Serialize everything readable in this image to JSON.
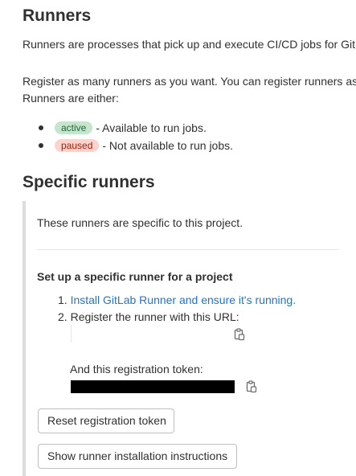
{
  "runners": {
    "title": "Runners",
    "intro": "Runners are processes that pick up and execute CI/CD jobs for GitLab.",
    "register_line1": "Register as many runners as you want. You can register runners as separate users, on separate servers, and on your local machine.",
    "register_line2": "Runners are either:",
    "statuses": [
      {
        "badge": "active",
        "text": "- Available to run jobs.",
        "color": "#c3e6cd"
      },
      {
        "badge": "paused",
        "text": "- Not available to run jobs.",
        "color": "#fdd4cd"
      }
    ]
  },
  "specific": {
    "title": "Specific runners",
    "description": "These runners are specific to this project.",
    "setup_title": "Set up a specific runner for a project",
    "steps": {
      "step1_link": "Install GitLab Runner and ensure it's running.",
      "step2_text": "Register the runner with this URL:"
    },
    "token_label": "And this registration token:",
    "reset_button": "Reset registration token",
    "show_button": "Show runner installation instructions"
  },
  "icons": {
    "copy_url": "clipboard-icon",
    "copy_token": "clipboard-icon"
  },
  "colors": {
    "link": "#1f75cb",
    "active_badge_bg": "#c3e6cd",
    "paused_badge_bg": "#fdd4cd"
  }
}
